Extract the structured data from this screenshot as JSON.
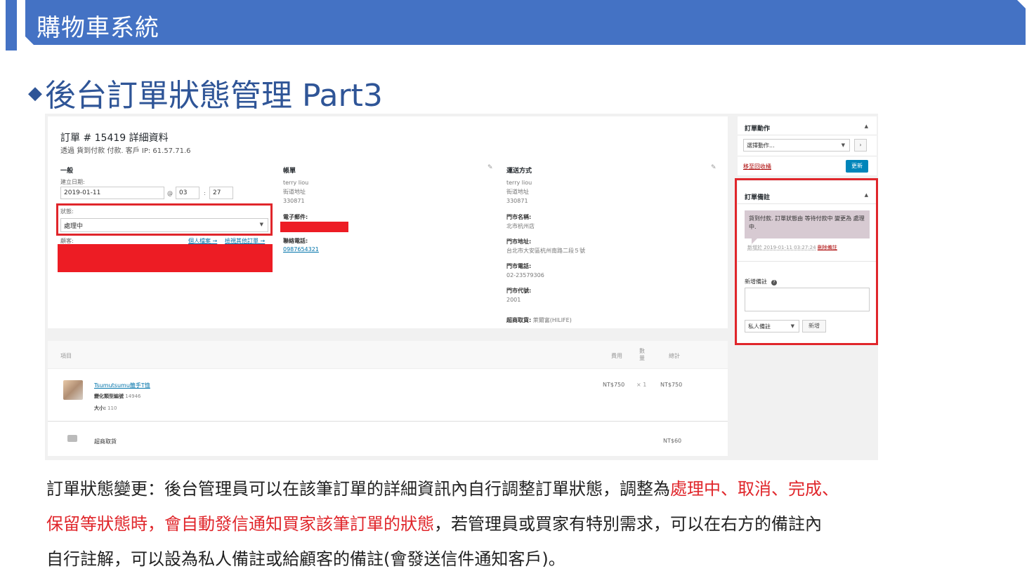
{
  "header": {
    "title": "購物車系統"
  },
  "heading": {
    "diamond": "◆",
    "text": "後台訂單狀態管理  Part3"
  },
  "order": {
    "title": "訂單 # 15419 詳細資料",
    "subtitle": "透過 貨到付款 付款. 客戶 IP: 61.57.71.6",
    "general": {
      "heading": "一般",
      "date_label": "建立日期:",
      "date_value": "2019-01-11",
      "at": "@",
      "hour": "03",
      "colon": ":",
      "minute": "27",
      "status_label": "狀態:",
      "status_value": "處理中",
      "customer_label": "顧客:",
      "profile_link": "個人檔案 →",
      "other_orders_link": "檢視其他訂單 →"
    },
    "billing": {
      "heading": "帳單",
      "name": "terry liou",
      "street": "街道地址",
      "zip": "330871",
      "email_label": "電子郵件:",
      "phone_label": "聯絡電話:",
      "phone": "0987654321"
    },
    "shipping": {
      "heading": "運送方式",
      "name": "terry liou",
      "street": "街道地址",
      "zip": "330871",
      "store_name_label": "門市名稱:",
      "store_name": "北市杭州店",
      "store_addr_label": "門市地址:",
      "store_addr": "台北市大安區杭州南路二段５號",
      "store_phone_label": "門市電話:",
      "store_phone": "02-23579306",
      "store_code_label": "門市代號:",
      "store_code": "2001",
      "pickup_label": "超商取貨:",
      "pickup": "萊爾富(HILIFE)"
    }
  },
  "items": {
    "col_item": "項目",
    "col_cost": "費用",
    "col_qty": "數量",
    "col_total": "總計",
    "product_name": "Tsumutsumu籤手T恤",
    "variation_label": "變化類型編號",
    "variation_id": "14946",
    "size_label": "大小:",
    "size": "110",
    "price": "NT$750",
    "qty": "× 1",
    "line_total": "NT$750",
    "shipping_name": "超商取貨",
    "shipping_cost": "NT$60"
  },
  "actions_box": {
    "title": "訂單動作",
    "select": "選擇動作...",
    "go": "›",
    "trash": "移至回收桶",
    "update": "更新"
  },
  "notes_box": {
    "title": "訂單備註",
    "note": "貨到付款. 訂單狀態由 等待付款中 變更為 處理中.",
    "meta": "新增於 2019-01-11 03:27:24",
    "delete": "刪除備註",
    "add_label": "新增備註",
    "help": "?",
    "type": "私人備註",
    "add_button": "新增"
  },
  "paragraph": {
    "p1": "訂單狀態變更：後台管理員可以在該筆訂單的詳細資訊內自行調整訂單狀態，調整為",
    "p1_red": "處理中、取消、完成、",
    "p2_red": "保留等狀態時，會自動發信通知買家該筆訂單的狀態",
    "p2": "，若管理員或買家有特別需求，可以在右方的備註內",
    "p3": "自行註解，可以設為私人備註或給顧客的備註(會發送信件通知客戶)。"
  }
}
